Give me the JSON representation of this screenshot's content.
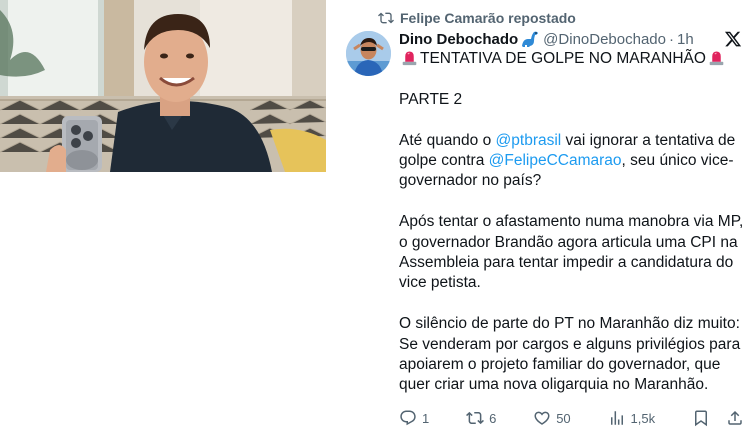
{
  "repost": {
    "label": "Felipe Camarão repostado",
    "icon": "repost-icon"
  },
  "author": {
    "name": "Dino Debochado",
    "badge_icon": "dinosaur-emoji-icon",
    "handle": "@DinoDebochado",
    "separator": "·",
    "time": "1h"
  },
  "tweet": {
    "title": "TENTATIVA DE GOLPE NO MARANHÃO",
    "title_icon": "police-siren-emoji-icon",
    "part": "PARTE 2",
    "p1_a": "Até quando o ",
    "p1_mention1": "@ptbrasil",
    "p1_b": " vai ignorar a tentativa de golpe contra ",
    "p1_mention2": "@FelipeCCamarao",
    "p1_c": ", seu único vice-governador no país?",
    "p2": "Após tentar o afastamento numa manobra via MP, o governador Brandão agora articula uma CPI na Assembleia para tentar impedir a candidatura do vice petista.",
    "p3": "O silêncio de parte do PT no Maranhão diz muito: Se venderam por cargos e alguns privilégios para apoiarem o projeto familiar do governador, que quer criar uma nova oligarquia no Maranhão."
  },
  "actions": {
    "replies": "1",
    "reposts": "6",
    "likes": "50",
    "views": "1,5k"
  },
  "colors": {
    "text": "#0f1419",
    "secondary": "#536471",
    "link": "#1d9bf0"
  }
}
